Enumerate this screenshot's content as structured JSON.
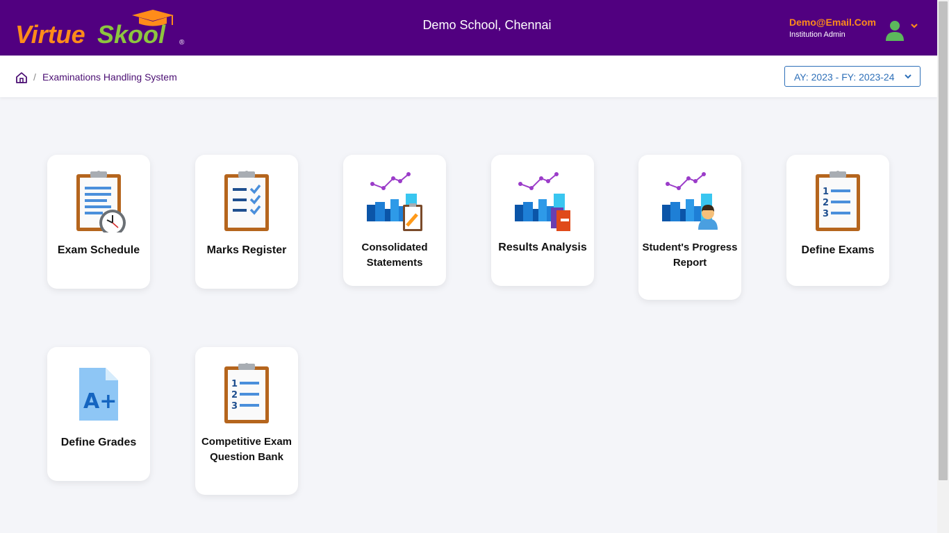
{
  "header": {
    "logo_text_a": "Virtue",
    "logo_text_b": "Skool",
    "logo_reg": "®",
    "school_name": "Demo School, Chennai",
    "user_email": "Demo@Email.Com",
    "user_role": "Institution Admin"
  },
  "breadcrumb": {
    "separator": "/",
    "current": "Examinations Handling System"
  },
  "year_selector": {
    "selected": "AY: 2023 - FY: 2023-24"
  },
  "modules": [
    {
      "label": "Exam Schedule",
      "icon": "clipboard-clock-icon"
    },
    {
      "label": "Marks Register",
      "icon": "clipboard-checklist-icon"
    },
    {
      "label": "Consolidated Statements",
      "icon": "chart-clipboard-icon"
    },
    {
      "label": "Results Analysis",
      "icon": "chart-books-icon"
    },
    {
      "label": "Student's Progress Report",
      "icon": "chart-student-icon"
    },
    {
      "label": "Define Exams",
      "icon": "clipboard-numbered-list-icon"
    },
    {
      "label": "Define Grades",
      "icon": "a-plus-document-icon"
    },
    {
      "label": "Competitive Exam Question Bank",
      "icon": "clipboard-numbered-list-icon"
    }
  ],
  "colors": {
    "header_bg": "#510080",
    "accent_orange": "#ff8c1a",
    "logo_green": "#8dc63f",
    "select_blue": "#2d6fb8"
  }
}
